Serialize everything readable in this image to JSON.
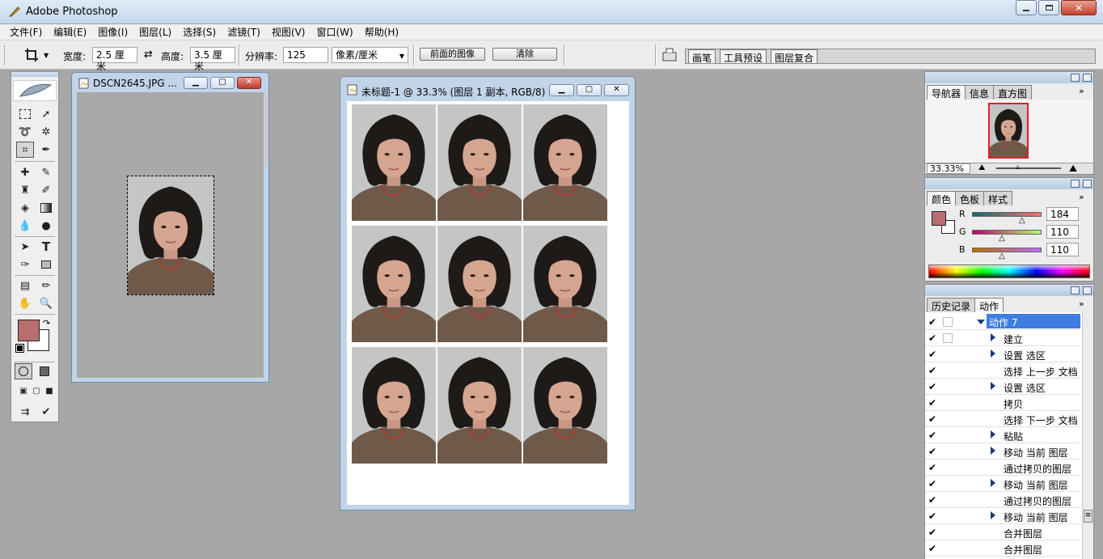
{
  "app": {
    "title": "Adobe Photoshop"
  },
  "menu": [
    "文件(F)",
    "编辑(E)",
    "图像(I)",
    "图层(L)",
    "选择(S)",
    "滤镜(T)",
    "视图(V)",
    "窗口(W)",
    "帮助(H)"
  ],
  "options": {
    "width_label": "宽度:",
    "width_value": "2.5 厘米",
    "height_label": "高度:",
    "height_value": "3.5 厘米",
    "resolution_label": "分辨率:",
    "resolution_value": "125",
    "unit_value": "像素/厘米",
    "front_image_button": "前面的图像",
    "clear_button": "清除",
    "well_tabs": [
      "画笔",
      "工具预设",
      "图层复合"
    ]
  },
  "doc1": {
    "title": "DSCN2645.JPG ..."
  },
  "doc2": {
    "title": "未标题-1 @ 33.3% (图层 1 副本, RGB/8)"
  },
  "navigator": {
    "tabs": [
      "导航器",
      "信息",
      "直方图"
    ],
    "zoom": "33.33%"
  },
  "color": {
    "tabs": [
      "颜色",
      "色板",
      "样式"
    ],
    "channels": [
      {
        "label": "R",
        "value": "184"
      },
      {
        "label": "G",
        "value": "110"
      },
      {
        "label": "B",
        "value": "110"
      }
    ],
    "foreground": "#b86e6e"
  },
  "actions": {
    "tabs": [
      "历史记录",
      "动作"
    ],
    "set_name": "动作 7",
    "items": [
      "建立",
      "设置 选区",
      "选择 上一步 文档",
      "设置 选区",
      "拷贝",
      "选择 下一步 文档",
      "粘贴",
      "移动 当前 图层",
      "通过拷贝的图层",
      "移动 当前 图层",
      "通过拷贝的图层",
      "移动 当前 图层",
      "合并图层",
      "合并图层"
    ],
    "expandable": [
      true,
      true,
      false,
      true,
      false,
      false,
      true,
      true,
      false,
      true,
      false,
      true,
      false,
      false
    ]
  },
  "colors": {
    "accent": "#3d7ee0",
    "foreground_swatch": "#b86e6e"
  }
}
